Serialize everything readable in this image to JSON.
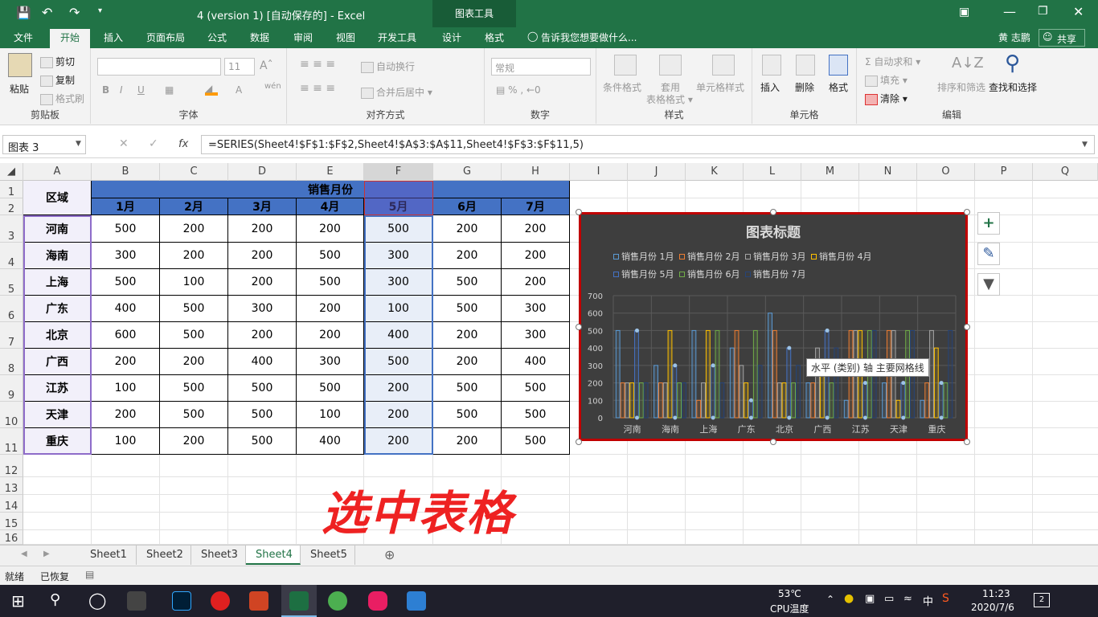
{
  "titlebar": {
    "doc_title": "4 (version 1) [自动保存的] - Excel",
    "context_tab": "图表工具",
    "user": "黄 志鹏",
    "share": "共享"
  },
  "ribbon_tabs": [
    "文件",
    "开始",
    "插入",
    "页面布局",
    "公式",
    "数据",
    "审阅",
    "视图",
    "开发工具",
    "设计",
    "格式"
  ],
  "tell_me": "告诉我您想要做什么...",
  "ribbon": {
    "paste": "粘贴",
    "cut": "剪切",
    "copy": "复制",
    "format_painter": "格式刷",
    "clipboard": "剪贴板",
    "font_size": "11",
    "font_group": "字体",
    "wrap": "自动换行",
    "merge": "合并后居中",
    "align_group": "对齐方式",
    "number_format": "常规",
    "number_group": "数字",
    "cond_format": "条件格式",
    "table_format": "套用\n表格格式",
    "cell_style": "单元格样式",
    "styles_group": "样式",
    "insert": "插入",
    "delete": "删除",
    "format": "格式",
    "cells_group": "单元格",
    "autosum": "自动求和",
    "fill": "填充",
    "clear": "清除",
    "sort": "排序和筛选",
    "find": "查找和选择",
    "edit_group": "编辑"
  },
  "formula_bar": {
    "name_box": "图表 3",
    "fx": "fx",
    "formula": "=SERIES(Sheet4!$F$1:$F$2,Sheet4!$A$3:$A$11,Sheet4!$F$3:$F$11,5)"
  },
  "columns": [
    "A",
    "B",
    "C",
    "D",
    "E",
    "F",
    "G",
    "H",
    "I",
    "J",
    "K",
    "L",
    "M",
    "N",
    "O",
    "P",
    "Q"
  ],
  "rows": [
    "1",
    "2",
    "3",
    "4",
    "5",
    "6",
    "7",
    "8",
    "9",
    "10",
    "11",
    "12",
    "13",
    "14",
    "15",
    "16"
  ],
  "table": {
    "region_header": "区域",
    "month_header": "销售月份",
    "months": [
      "1月",
      "2月",
      "3月",
      "4月",
      "5月",
      "6月",
      "7月"
    ],
    "regions": [
      "河南",
      "海南",
      "上海",
      "广东",
      "北京",
      "广西",
      "江苏",
      "天津",
      "重庆"
    ],
    "values": [
      [
        500,
        200,
        200,
        200,
        500,
        200,
        200
      ],
      [
        300,
        200,
        200,
        500,
        300,
        200,
        200
      ],
      [
        500,
        100,
        200,
        500,
        300,
        500,
        200
      ],
      [
        400,
        500,
        300,
        200,
        100,
        500,
        300
      ],
      [
        600,
        500,
        200,
        200,
        400,
        200,
        300
      ],
      [
        200,
        200,
        400,
        300,
        500,
        200,
        400
      ],
      [
        100,
        500,
        500,
        500,
        200,
        500,
        500
      ],
      [
        200,
        500,
        500,
        100,
        200,
        500,
        500
      ],
      [
        100,
        200,
        500,
        400,
        200,
        200,
        500
      ]
    ]
  },
  "chart_data": {
    "type": "bar",
    "title": "图表标题",
    "categories": [
      "河南",
      "海南",
      "上海",
      "广东",
      "北京",
      "广西",
      "江苏",
      "天津",
      "重庆"
    ],
    "series": [
      {
        "name": "销售月份 1月",
        "values": [
          500,
          300,
          500,
          400,
          600,
          200,
          100,
          200,
          100
        ]
      },
      {
        "name": "销售月份 2月",
        "values": [
          200,
          200,
          100,
          500,
          500,
          200,
          500,
          500,
          200
        ]
      },
      {
        "name": "销售月份 3月",
        "values": [
          200,
          200,
          200,
          300,
          200,
          400,
          500,
          500,
          500
        ]
      },
      {
        "name": "销售月份 4月",
        "values": [
          200,
          500,
          500,
          200,
          200,
          300,
          500,
          100,
          400
        ]
      },
      {
        "name": "销售月份 5月",
        "values": [
          500,
          300,
          300,
          100,
          400,
          500,
          200,
          200,
          200
        ]
      },
      {
        "name": "销售月份 6月",
        "values": [
          200,
          200,
          500,
          500,
          200,
          200,
          500,
          500,
          200
        ]
      },
      {
        "name": "销售月份 7月",
        "values": [
          200,
          200,
          200,
          300,
          300,
          400,
          500,
          500,
          500
        ]
      }
    ],
    "colors": [
      "#5b9bd5",
      "#ed7d31",
      "#a5a5a5",
      "#ffc000",
      "#4472c4",
      "#70ad47",
      "#264478"
    ],
    "ylim": [
      0,
      700
    ],
    "yticks": [
      "0",
      "100",
      "200",
      "300",
      "400",
      "500",
      "600",
      "700"
    ],
    "legend_position": "top",
    "tooltip": "水平 (类别) 轴 主要网格线"
  },
  "sheets": [
    "Sheet1",
    "Sheet2",
    "Sheet3",
    "Sheet4",
    "Sheet5"
  ],
  "active_sheet": "Sheet4",
  "status": {
    "ready": "就绪",
    "recovered": "已恢复"
  },
  "overlay_text": "选中表格",
  "taskbar": {
    "temp": "53℃",
    "cpu": "CPU温度",
    "ime": "中",
    "time": "11:23",
    "date": "2020/7/6",
    "notif": "2"
  }
}
